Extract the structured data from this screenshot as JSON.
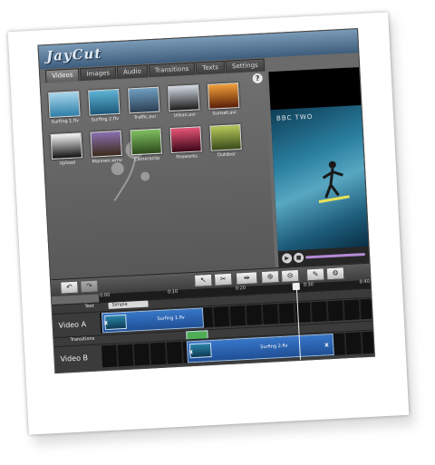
{
  "app": {
    "logo": "JayCut"
  },
  "tabs": [
    "Videos",
    "Images",
    "Audio",
    "Transitions",
    "Texts",
    "Settings"
  ],
  "help_label": "?",
  "library": {
    "clips": [
      {
        "label": "Surfing 1.flv",
        "thumb_top": "#a9d6ec",
        "thumb_bottom": "#2d7ea8"
      },
      {
        "label": "Surfing 2.flv",
        "thumb_top": "#5fb4d6",
        "thumb_bottom": "#1c5878"
      },
      {
        "label": "Traffic.avi",
        "thumb_top": "#6f9fc0",
        "thumb_bottom": "#2c3e54"
      },
      {
        "label": "Urban.avi",
        "thumb_top": "#d0d7e0",
        "thumb_bottom": "#1a1a1a"
      },
      {
        "label": "Sunset.avi",
        "thumb_top": "#f2a13b",
        "thumb_bottom": "#5a1e06"
      },
      {
        "label": "Upload",
        "thumb_top": "#f5f5f5",
        "thumb_bottom": "#111111"
      },
      {
        "label": "Mannen.wmv",
        "thumb_top": "#8a6fb0",
        "thumb_bottom": "#3c2b1a"
      },
      {
        "label": "Cameraclip",
        "thumb_top": "#7fbf62",
        "thumb_bottom": "#2d4b1c"
      },
      {
        "label": "Fireworks",
        "thumb_top": "#e85577",
        "thumb_bottom": "#3a0616"
      },
      {
        "label": "Outdoor",
        "thumb_top": "#b6c95a",
        "thumb_bottom": "#3a4a1a"
      }
    ]
  },
  "preview": {
    "channel": "BBC TWO"
  },
  "player": {
    "play_icon": "play-icon",
    "stop_icon": "stop-icon",
    "seek_color": "#b48ad6"
  },
  "toolbar": {
    "undo": "↶",
    "redo": "↷",
    "select": "↖",
    "split": "✂",
    "adjust": "⇹",
    "zoom_in": "⊕",
    "zoom_out": "⊖",
    "pick": "✎",
    "settings": "⚙"
  },
  "timeline": {
    "ticks": [
      "0:00",
      "0:10",
      "0:20",
      "0:30",
      "0:40"
    ],
    "tracks": {
      "text": "Text",
      "video_a": "Video A",
      "transitions": "Transitions",
      "video_b": "Video B"
    },
    "text_clip": "Simple",
    "clips": {
      "a": "Surfing 1.flv",
      "b": "Surfing 2.flv"
    },
    "x": "x"
  }
}
